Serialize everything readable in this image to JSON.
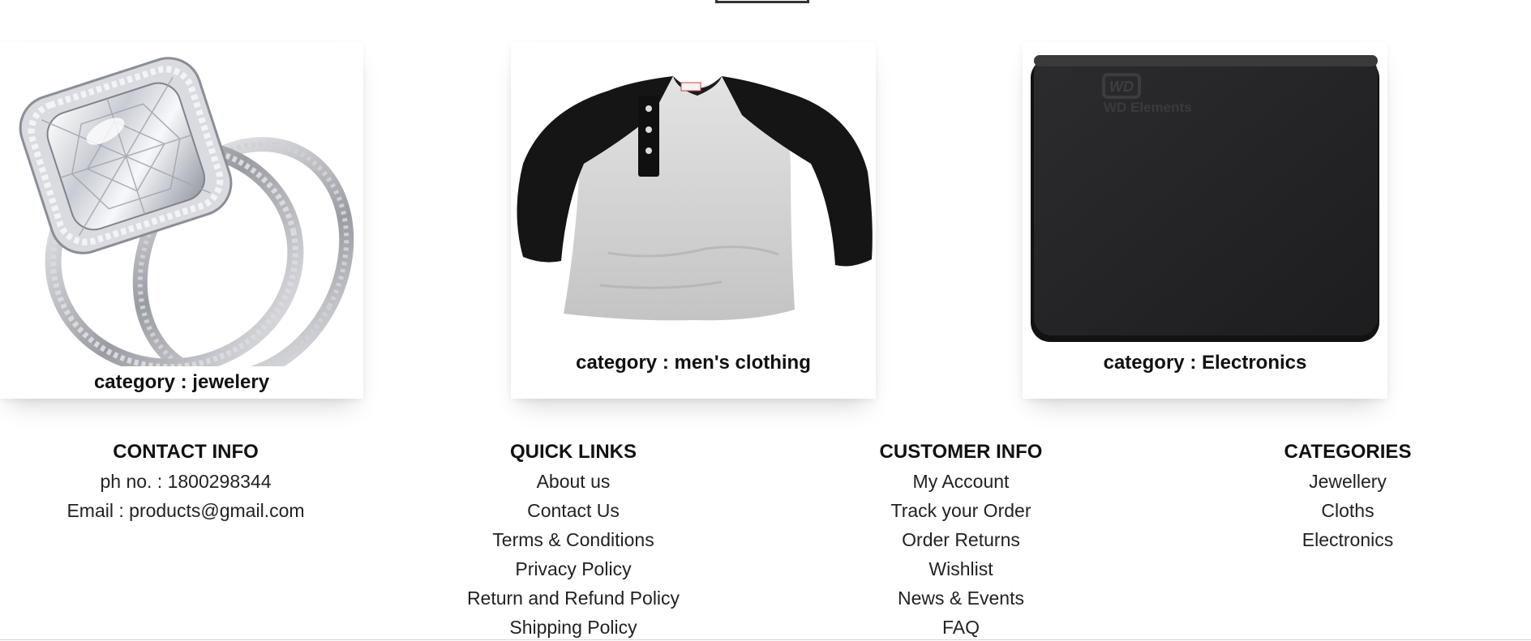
{
  "cards": [
    {
      "caption": "category : jewelery",
      "image": "diamond-ring-image"
    },
    {
      "caption": "category : men's clothing",
      "image": "raglan-henley-shirt-image"
    },
    {
      "caption": "category : Electronics",
      "image": "wd-external-hard-drive-image",
      "product_brand_text": "WD Elements",
      "logo_text": "WD"
    }
  ],
  "footer": {
    "contact": {
      "title": "CONTACT INFO",
      "phone": "ph no. : 1800298344",
      "email": "Email : products@gmail.com"
    },
    "quick_links": {
      "title": "QUICK LINKS",
      "items": [
        "About us",
        "Contact Us",
        "Terms & Conditions",
        "Privacy Policy",
        "Return and Refund Policy",
        "Shipping Policy"
      ]
    },
    "customer_info": {
      "title": "CUSTOMER INFO",
      "items": [
        "My Account",
        "Track your Order",
        "Order Returns",
        "Wishlist",
        "News & Events",
        "FAQ"
      ]
    },
    "categories": {
      "title": "CATEGORIES",
      "items": [
        "Jewellery",
        "Cloths",
        "Electronics"
      ]
    }
  }
}
